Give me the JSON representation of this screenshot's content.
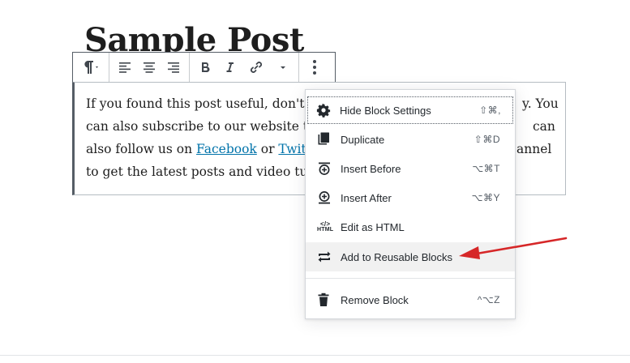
{
  "post": {
    "title": "Sample Post"
  },
  "paragraph": {
    "line1": "If you found this post useful, don't f",
    "line1_end": "y. You",
    "line2": "can also subscribe to our website to",
    "line2_end": "can",
    "line3_pre": "also follow us on ",
    "link_facebook": "Facebook",
    "line3_mid": " or ",
    "link_twitter": "Twitt",
    "line3_end": "annel",
    "line4": "to get the latest posts and video tuto"
  },
  "toolbar": {
    "paragraph_icon": "pilcrow-icon",
    "align_left_icon": "align-left-icon",
    "align_center_icon": "align-center-icon",
    "align_right_icon": "align-right-icon",
    "bold_icon": "bold-icon",
    "italic_icon": "italic-icon",
    "link_icon": "link-icon",
    "more_icon": "more-vertical-icon"
  },
  "menu": {
    "items": [
      {
        "label": "Hide Block Settings",
        "shortcut": "⇧⌘,",
        "icon": "gear-icon"
      },
      {
        "label": "Duplicate",
        "shortcut": "⇧⌘D",
        "icon": "duplicate-icon"
      },
      {
        "label": "Insert Before",
        "shortcut": "⌥⌘T",
        "icon": "insert-before-icon"
      },
      {
        "label": "Insert After",
        "shortcut": "⌥⌘Y",
        "icon": "insert-after-icon"
      },
      {
        "label": "Edit as HTML",
        "shortcut": "",
        "icon": "html-icon"
      },
      {
        "label": "Add to Reusable Blocks",
        "shortcut": "",
        "icon": "reusable-icon"
      },
      {
        "label": "Remove Block",
        "shortcut": "^⌥Z",
        "icon": "trash-icon"
      }
    ],
    "html_icon_text_top": "</>",
    "html_icon_text_bottom": "HTML"
  },
  "colors": {
    "link": "#0073aa",
    "annotation": "#d62728",
    "hover_bg": "#f1f1f1"
  }
}
